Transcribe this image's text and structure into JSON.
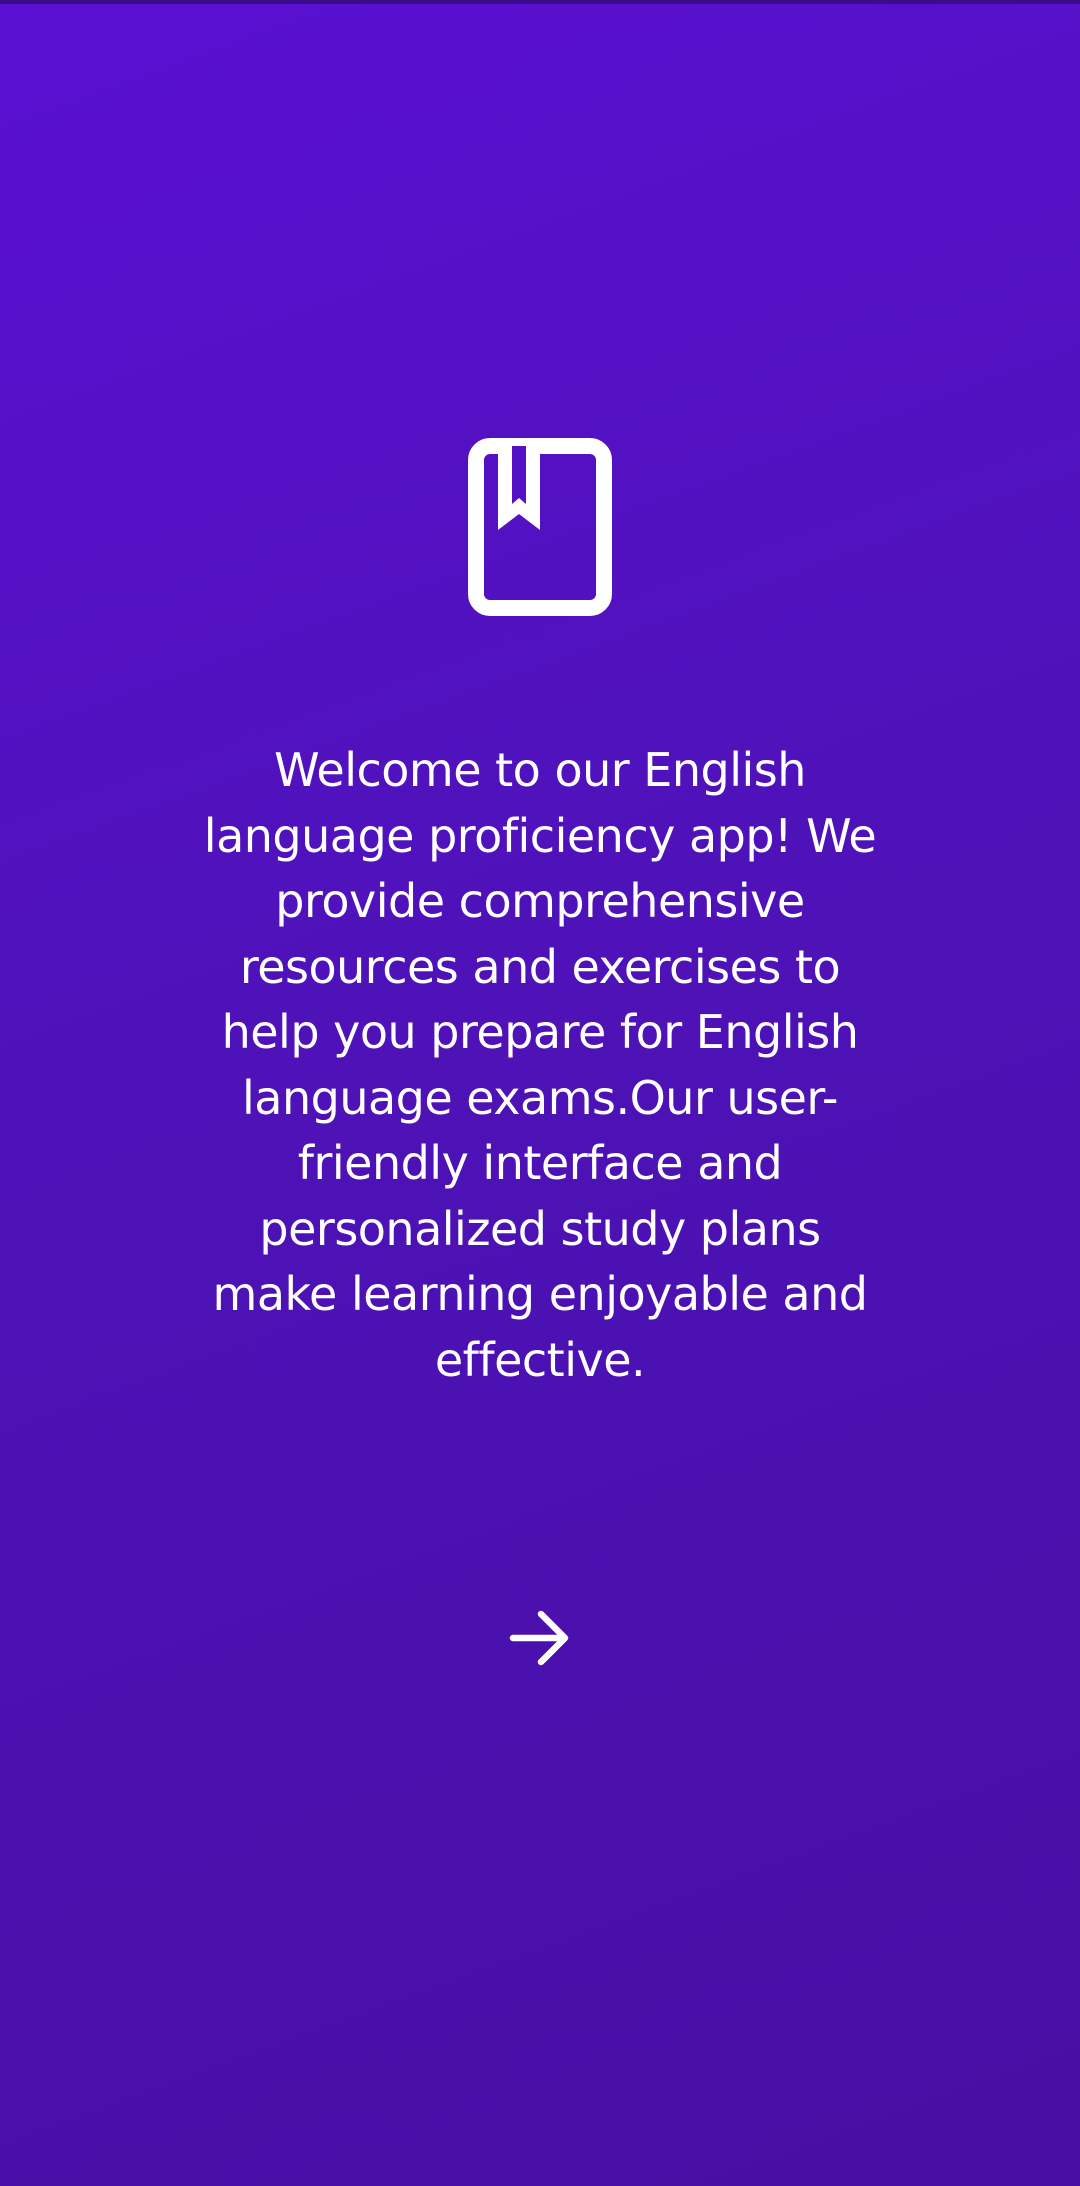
{
  "onboarding": {
    "icon": "bookmark-book-icon",
    "message": "Welcome to our English language proficiency app! We provide comprehensive resources and exercises to help you prepare for English language exams.Our user-friendly interface and personalized study plans make learning enjoyable and effective.",
    "next_icon": "arrow-right-icon"
  },
  "colors": {
    "background_top": "#5a10d2",
    "background_bottom": "#470fa3",
    "foreground": "#ffffff"
  }
}
